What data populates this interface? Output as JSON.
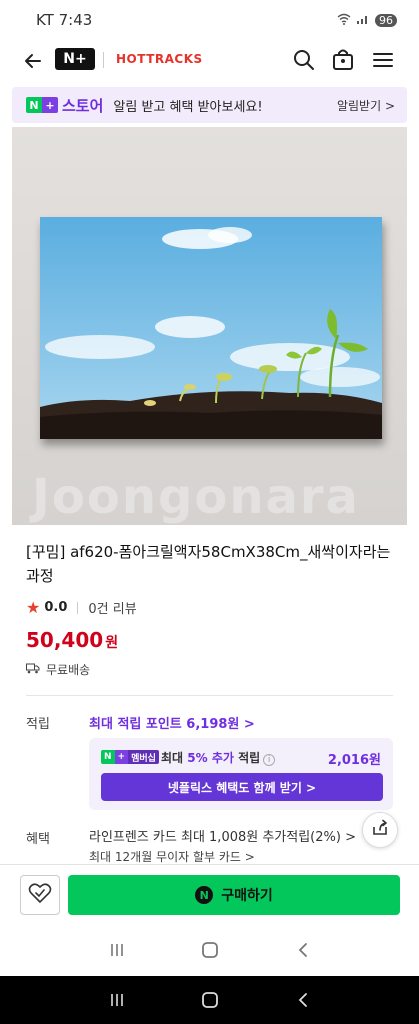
{
  "status_bar": {
    "carrier": "KT",
    "time": "7:43",
    "battery": "96"
  },
  "nav": {
    "logo_np": "N+",
    "logo_hottracks": "HOTTRACKS"
  },
  "banner": {
    "store_name": "스토어",
    "message": "알림 받고 혜택 받아보세요!",
    "action": "알림받기 >"
  },
  "hero": {
    "watermark": "Joongonara"
  },
  "product": {
    "title": "[꾸밈] af620-폼아크릴액자58CmX38Cm_새싹이자라는과정",
    "rating": "0.0",
    "reviews": "0건 리뷰",
    "price": "50,400",
    "price_unit": "원",
    "shipping": "무료배송"
  },
  "points": {
    "label": "적립",
    "max_points": "최대 적립 포인트 6,198원 >",
    "membership_badge": "멤버십",
    "extra_text_prefix": "최대 ",
    "extra_text_accent": "5% 추가",
    "extra_text_suffix": " 적립",
    "extra_amount": "2,016원",
    "netflix_button": "넷플릭스 혜택도 함께 받기 >"
  },
  "benefits": {
    "label": "혜택",
    "line1": "라인프렌즈 카드 최대 1,008원 추가적립(2%) >",
    "line2": "최대 12개월 무이자 할부 카드 >"
  },
  "buy_bar": {
    "buy_label": "구매하기"
  },
  "colors": {
    "naver_green": "#03c75a",
    "plus_purple": "#6f2ee0",
    "price_red": "#d0021b"
  }
}
